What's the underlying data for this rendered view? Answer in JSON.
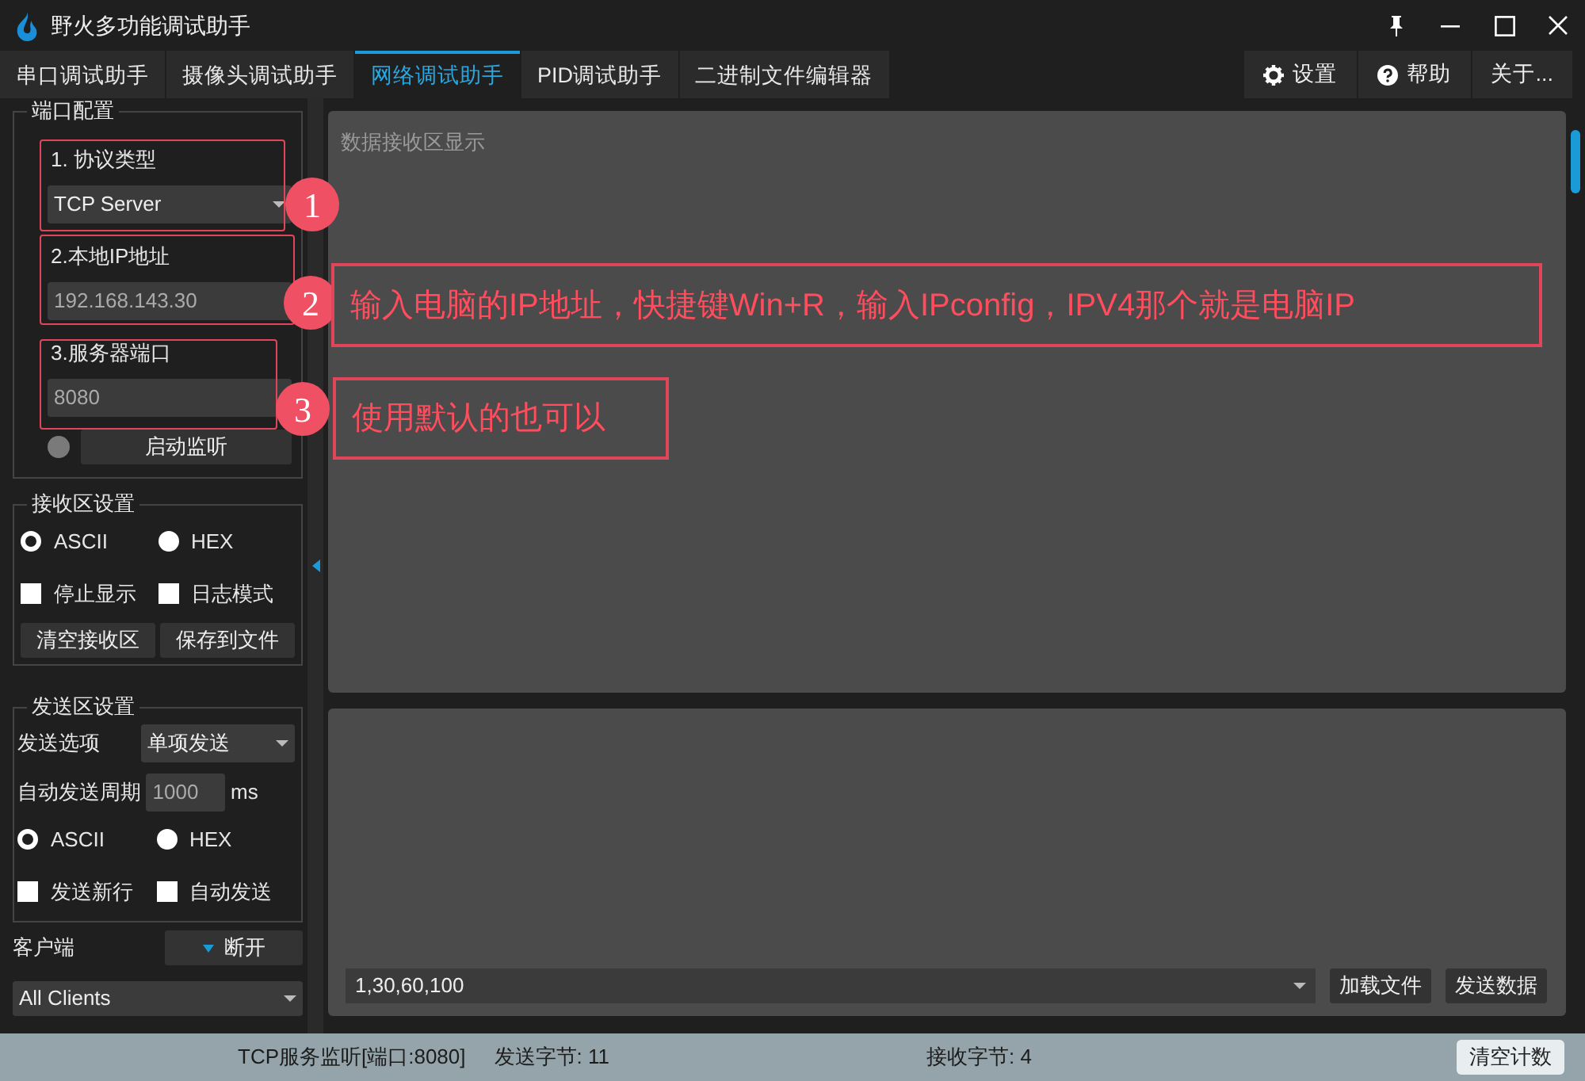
{
  "window": {
    "title": "野火多功能调试助手"
  },
  "tabs": [
    {
      "label": "串口调试助手",
      "selected": false
    },
    {
      "label": "摄像头调试助手",
      "selected": false
    },
    {
      "label": "网络调试助手",
      "selected": true
    },
    {
      "label": "PID调试助手",
      "selected": false
    },
    {
      "label": "二进制文件编辑器",
      "selected": false
    }
  ],
  "toolbar_buttons": [
    {
      "label": "设置",
      "kind": "gear"
    },
    {
      "label": "帮助",
      "kind": "help"
    },
    {
      "label": "关于...",
      "kind": "plain"
    }
  ],
  "port_config": {
    "title": "端口配置",
    "fields": [
      {
        "label": "1. 协议类型",
        "kind": "select",
        "value": "TCP Server"
      },
      {
        "label": "2.本地IP地址",
        "kind": "input",
        "value": "192.168.143.30"
      },
      {
        "label": "3.服务器端口",
        "kind": "input",
        "value": "8080"
      }
    ],
    "listening": false,
    "listen_button": "启动监听"
  },
  "receive_settings": {
    "title": "接收区设置",
    "radios": [
      {
        "label": "ASCII",
        "selected": true
      },
      {
        "label": "HEX",
        "selected": false
      }
    ],
    "checkboxes": [
      {
        "label": "停止显示",
        "checked": false
      },
      {
        "label": "日志模式",
        "checked": false
      }
    ],
    "buttons": [
      "清空接收区",
      "保存到文件"
    ]
  },
  "send_settings": {
    "title": "发送区设置",
    "option_label": "发送选项",
    "option_value": "单项发送",
    "period_label": "自动发送周期",
    "period_value": "1000",
    "period_unit": "ms",
    "radios": [
      {
        "label": "ASCII",
        "selected": true
      },
      {
        "label": "HEX",
        "selected": false
      }
    ],
    "checkboxes": [
      {
        "label": "发送新行",
        "checked": false
      },
      {
        "label": "自动发送",
        "checked": false
      }
    ]
  },
  "clients": {
    "label": "客户端",
    "button": "断开",
    "select": "All Clients"
  },
  "receive_area": {
    "placeholder": "数据接收区显示"
  },
  "send_area": {
    "history": "1,30,60,100",
    "buttons": [
      "加载文件",
      "发送数据"
    ]
  },
  "status_bar": {
    "listen": "TCP服务监听[端口:8080]",
    "sent": "发送字节: 11",
    "received": "接收字节: 4",
    "button": "清空计数"
  },
  "annotations": [
    {
      "number": "1"
    },
    {
      "number": "2",
      "note": "输入电脑的IP地址，快捷键Win+R，输入IPconfig，IPV4那个就是电脑IP"
    },
    {
      "number": "3",
      "note": "使用默认的也可以"
    }
  ]
}
